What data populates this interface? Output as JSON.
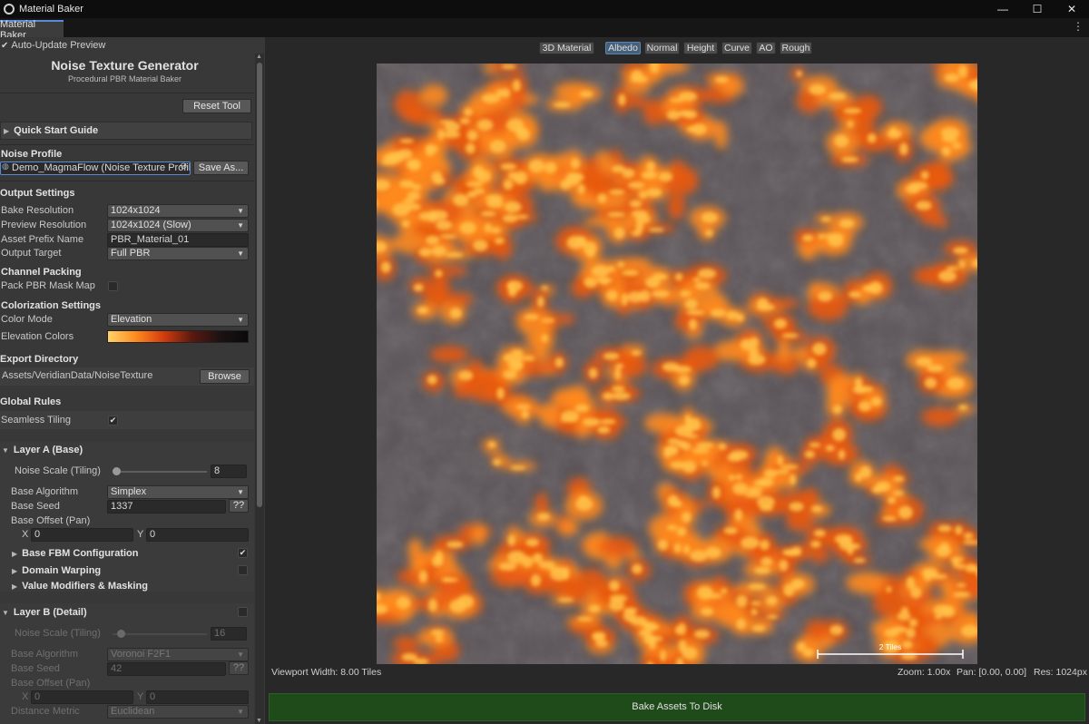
{
  "window": {
    "title": "Material Baker",
    "tab": "Material Baker",
    "controls": {
      "minimize": "—",
      "maximize": "☐",
      "close": "✕"
    },
    "menu_glyph": "⋮"
  },
  "left": {
    "auto_update": {
      "label": "Auto-Update Preview",
      "checked": true
    },
    "header": {
      "title": "Noise Texture Generator",
      "subtitle": "Procedural PBR Material Baker"
    },
    "reset_button": "Reset Tool",
    "quick_start": "Quick Start Guide",
    "noise_profile": {
      "heading": "Noise Profile",
      "value": "Demo_MagmaFlow (Noise Texture Profile)",
      "save_as": "Save As..."
    },
    "output_settings": {
      "heading": "Output Settings",
      "bake_resolution": {
        "label": "Bake Resolution",
        "value": "1024x1024"
      },
      "preview_resolution": {
        "label": "Preview Resolution",
        "value": "1024x1024 (Slow)"
      },
      "asset_prefix": {
        "label": "Asset Prefix Name",
        "value": "PBR_Material_01"
      },
      "output_target": {
        "label": "Output Target",
        "value": "Full PBR"
      }
    },
    "channel_packing": {
      "heading": "Channel Packing",
      "pack_label": "Pack PBR Mask Map"
    },
    "colorization": {
      "heading": "Colorization Settings",
      "color_mode": {
        "label": "Color Mode",
        "value": "Elevation"
      },
      "elevation_colors": {
        "label": "Elevation Colors"
      },
      "gradient": [
        "#ffd36a",
        "#ff8a1f",
        "#d13b0e",
        "#5a1a10",
        "#1c1212",
        "#0a0a0a"
      ]
    },
    "export": {
      "heading": "Export Directory",
      "path": "Assets/VeridianData/NoiseTexture",
      "browse": "Browse"
    },
    "global_rules": {
      "heading": "Global Rules",
      "seamless_label": "Seamless Tiling"
    },
    "layer_a": {
      "heading": "Layer A (Base)",
      "noise_scale": {
        "label": "Noise Scale (Tiling)",
        "value": "8"
      },
      "base_algorithm": {
        "label": "Base Algorithm",
        "value": "Simplex"
      },
      "base_seed": {
        "label": "Base Seed",
        "value": "1337",
        "button": "??"
      },
      "base_offset": {
        "label": "Base Offset (Pan)",
        "x_label": "X",
        "x": "0",
        "y_label": "Y",
        "y": "0"
      },
      "fbm": "Base FBM Configuration",
      "domain_warping": "Domain Warping",
      "value_modifiers": "Value Modifiers & Masking"
    },
    "layer_b": {
      "heading": "Layer B (Detail)",
      "noise_scale": {
        "label": "Noise Scale (Tiling)",
        "value": "16"
      },
      "base_algorithm": {
        "label": "Base Algorithm",
        "value": "Voronoi F2F1"
      },
      "base_seed": {
        "label": "Base Seed",
        "value": "42",
        "button": "??"
      },
      "base_offset": {
        "label": "Base Offset (Pan)",
        "x_label": "X",
        "x": "0",
        "y_label": "Y",
        "y": "0"
      },
      "distance_metric": {
        "label": "Distance Metric",
        "value": "Euclidean"
      }
    }
  },
  "viewport": {
    "tabs": [
      "3D Material",
      "Albedo",
      "Normal",
      "Height",
      "Curve",
      "AO",
      "Rough"
    ],
    "active_tab": "Albedo",
    "scale_label": "2 Tiles",
    "status": {
      "width": "Viewport Width: 8.00 Tiles",
      "zoom": "Zoom: 1.00x",
      "pan": "Pan: [0.00, 0.00]",
      "res": "Res: 1024px"
    },
    "bake_button": "Bake Assets To Disk",
    "colors": {
      "base": "#5b5458",
      "dark": "#4a4348",
      "glow": "#ff8a1f",
      "hot": "#ffc24a",
      "edge": "#e85a12"
    }
  }
}
